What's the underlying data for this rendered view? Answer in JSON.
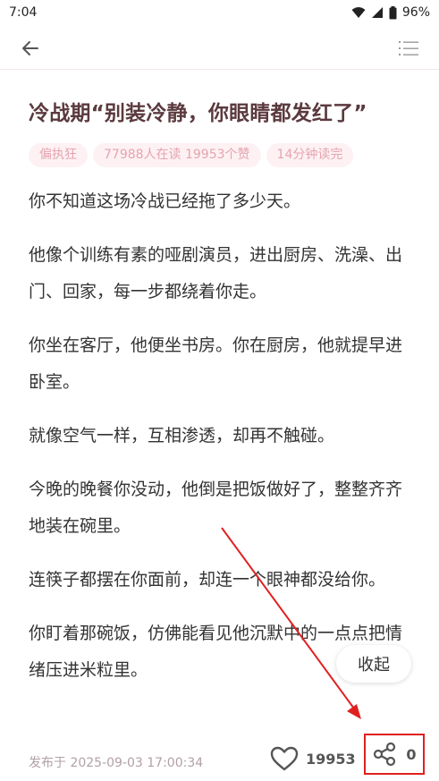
{
  "status": {
    "time": "7:04",
    "battery": "96%"
  },
  "article": {
    "title": "冷战期“别装冷静，你眼睛都发红了”",
    "tags": [
      "偏执狂",
      "77988人在读 19953个赞",
      "14分钟读完"
    ],
    "paragraphs": [
      "你不知道这场冷战已经拖了多少天。",
      "他像个训练有素的哑剧演员，进出厨房、洗澡、出门、回家，每一步都绕着你走。",
      "你坐在客厅，他便坐书房。你在厨房，他就提早进卧室。",
      "就像空气一样，互相渗透，却再不触碰。",
      "今晚的晚餐你没动，他倒是把饭做好了，整整齐齐地装在碗里。",
      "连筷子都摆在你面前，却连一个眼神都没给你。",
      "你盯着那碗饭，仿佛能看见他沉默中的一点点把情绪压进米粒里。"
    ]
  },
  "collapse_label": "收起",
  "footer": {
    "publish_text": "发布于 2025-09-03 17:00:34",
    "like_count": "19953",
    "share_count": "0"
  },
  "colors": {
    "accent": "#e6a4b0",
    "title": "#5b3a3f",
    "highlight": "#e02020"
  },
  "icons": {
    "back": "arrow-left-icon",
    "menu": "list-icon",
    "like": "heart-icon",
    "share": "share-icon"
  }
}
